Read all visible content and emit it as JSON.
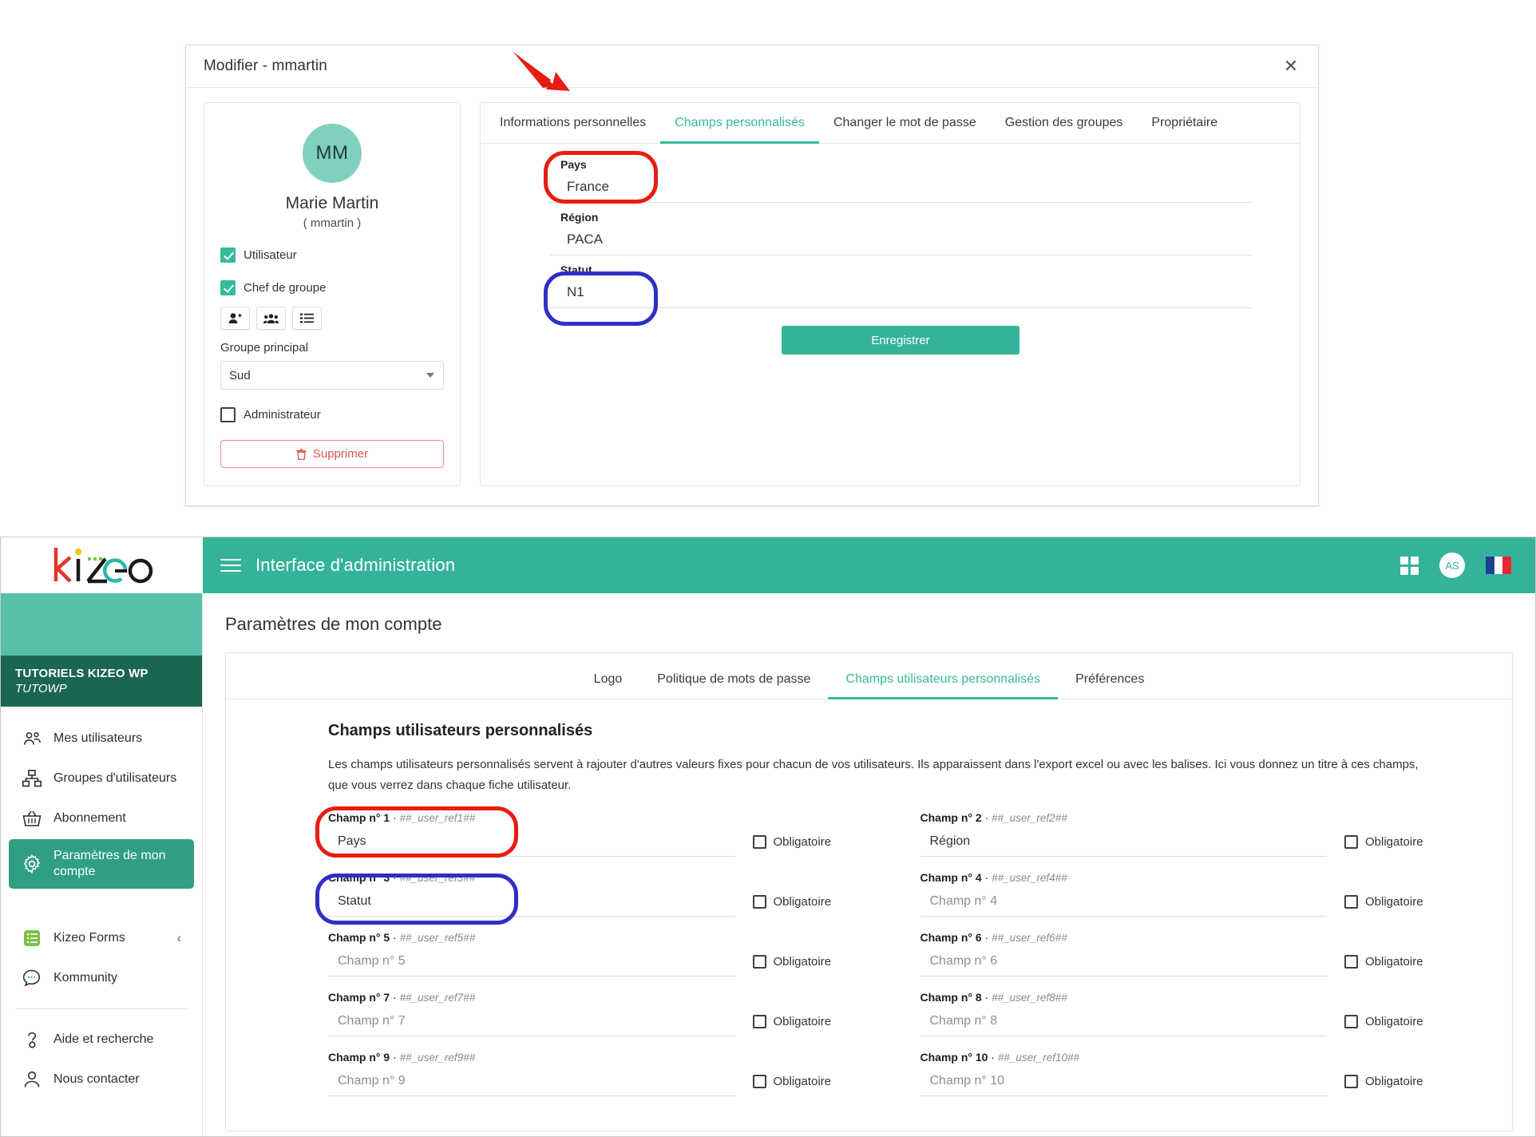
{
  "modal": {
    "title": "Modifier - mmartin",
    "close_icon": "close-icon",
    "profile": {
      "initials": "MM",
      "name": "Marie Martin",
      "login": "( mmartin )",
      "checkboxes": [
        {
          "label": "Utilisateur",
          "checked": true
        },
        {
          "label": "Chef de groupe",
          "checked": true
        }
      ],
      "icon_buttons": [
        "user-add-icon",
        "users-group-icon",
        "list-icon"
      ],
      "group_label": "Groupe principal",
      "group_value": "Sud",
      "admin_label": "Administrateur",
      "admin_checked": false,
      "delete_label": "Supprimer"
    },
    "tabs": [
      {
        "label": "Informations personnelles",
        "active": false
      },
      {
        "label": "Champs personnalisés",
        "active": true
      },
      {
        "label": "Changer le mot de passe",
        "active": false
      },
      {
        "label": "Gestion des groupes",
        "active": false
      },
      {
        "label": "Propriétaire",
        "active": false
      }
    ],
    "fields": [
      {
        "label": "Pays",
        "value": "France"
      },
      {
        "label": "Région",
        "value": "PACA"
      },
      {
        "label": "Statut",
        "value": "N1"
      }
    ],
    "save_label": "Enregistrer"
  },
  "app": {
    "logo_text": "kizeo",
    "topbar": {
      "menu_icon": "hamburger-menu-icon",
      "title": "Interface d'administration",
      "apps_icon": "grid-apps-icon",
      "avatar_initials": "AS",
      "flag_icon": "french-flag-icon"
    },
    "sidebar": {
      "account_name": "TUTORIELS KIZEO WP",
      "account_code": "TUTOWP",
      "items": [
        {
          "label": "Mes utilisateurs",
          "icon": "users-icon",
          "active": false
        },
        {
          "label": "Groupes d'utilisateurs",
          "icon": "org-chart-icon",
          "active": false
        },
        {
          "label": "Abonnement",
          "icon": "basket-icon",
          "active": false
        },
        {
          "label": "Paramètres de mon compte",
          "icon": "gear-icon",
          "active": true
        }
      ],
      "items2": [
        {
          "label": "Kizeo Forms",
          "icon": "kizeo-forms-icon",
          "chevron": "chevron-left-icon"
        },
        {
          "label": "Kommunity",
          "icon": "chat-bubble-icon",
          "chevron": ""
        }
      ],
      "items3": [
        {
          "label": "Aide et recherche",
          "icon": "question-mark-icon"
        },
        {
          "label": "Nous contacter",
          "icon": "person-support-icon"
        }
      ]
    },
    "page_title": "Paramètres de mon compte",
    "tabs": [
      {
        "label": "Logo",
        "active": false
      },
      {
        "label": "Politique de mots de passe",
        "active": false
      },
      {
        "label": "Champs utilisateurs personnalisés",
        "active": true
      },
      {
        "label": "Préférences",
        "active": false
      }
    ],
    "section_title": "Champs utilisateurs personnalisés",
    "section_desc": "Les champs utilisateurs personnalisés servent à rajouter d'autres valeurs fixes pour chacun de vos utilisateurs. Ils apparaissent dans l'export excel ou avec les balises. Ici vous donnez un titre à ces champs, que vous verrez dans chaque fiche utilisateur.",
    "obligatoire_label": "Obligatoire",
    "fields_left": [
      {
        "title": "Champ n° 1",
        "tag": "##_user_ref1##",
        "value": "Pays",
        "placeholder": "Champ n° 1",
        "filled": true,
        "required": false
      },
      {
        "title": "Champ n° 3",
        "tag": "##_user_ref3##",
        "value": "Statut",
        "placeholder": "Champ n° 3",
        "filled": true,
        "required": false
      },
      {
        "title": "Champ n° 5",
        "tag": "##_user_ref5##",
        "value": "Champ n° 5",
        "placeholder": "Champ n° 5",
        "filled": false,
        "required": false
      },
      {
        "title": "Champ n° 7",
        "tag": "##_user_ref7##",
        "value": "Champ n° 7",
        "placeholder": "Champ n° 7",
        "filled": false,
        "required": false
      },
      {
        "title": "Champ n° 9",
        "tag": "##_user_ref9##",
        "value": "Champ n° 9",
        "placeholder": "Champ n° 9",
        "filled": false,
        "required": false
      }
    ],
    "fields_right": [
      {
        "title": "Champ n° 2",
        "tag": "##_user_ref2##",
        "value": "Région",
        "placeholder": "Champ n° 2",
        "filled": true,
        "required": false
      },
      {
        "title": "Champ n° 4",
        "tag": "##_user_ref4##",
        "value": "Champ n° 4",
        "placeholder": "Champ n° 4",
        "filled": false,
        "required": false
      },
      {
        "title": "Champ n° 6",
        "tag": "##_user_ref6##",
        "value": "Champ n° 6",
        "placeholder": "Champ n° 6",
        "filled": false,
        "required": false
      },
      {
        "title": "Champ n° 8",
        "tag": "##_user_ref8##",
        "value": "Champ n° 8",
        "placeholder": "Champ n° 8",
        "filled": false,
        "required": false
      },
      {
        "title": "Champ n° 10",
        "tag": "##_user_ref10##",
        "value": "Champ n° 10",
        "placeholder": "Champ n° 10",
        "filled": false,
        "required": false
      }
    ]
  },
  "annotations": {
    "red_color": "#e81c12",
    "blue_color": "#2f2fc4",
    "arrow_color": "#e81c12"
  }
}
